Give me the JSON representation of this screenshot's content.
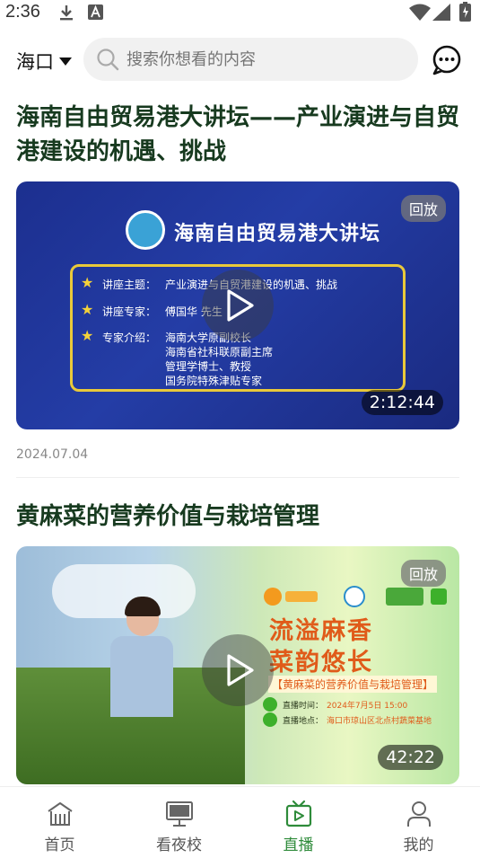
{
  "status_bar": {
    "time": "2:36"
  },
  "header": {
    "city": "海口",
    "search_placeholder": "搜索你想看的内容"
  },
  "feed": [
    {
      "title": "海南自由贸易港大讲坛——产业演进与自贸港建设的机遇、挑战",
      "badge": "回放",
      "duration": "2:12:44",
      "date": "2024.07.04",
      "thumbnail": {
        "banner_title": "海南自由贸易港大讲坛",
        "lines": [
          {
            "label": "讲座主题：",
            "text": "产业演进与自贸港建设的机遇、挑战"
          },
          {
            "label": "讲座专家：",
            "text": "傅国华  先生"
          },
          {
            "label": "专家介绍：",
            "text": "海南大学原副校长"
          }
        ],
        "extra_lines": [
          "海南省社科联原副主席",
          "管理学博士、教授",
          "国务院特殊津贴专家"
        ]
      }
    },
    {
      "title": "黄麻菜的营养价值与栽培管理",
      "badge": "回放",
      "duration": "42:22",
      "thumbnail": {
        "slogan_1": "流溢麻香",
        "slogan_2": "菜韵悠长",
        "topic": "【黄麻菜的营养价值与栽培管理】",
        "info": [
          {
            "label": "直播时间：",
            "value": "2024年7月5日 15:00"
          },
          {
            "label": "直播地点：",
            "value": "海口市琼山区北点村蔬菜基地"
          }
        ]
      }
    }
  ],
  "tabbar": [
    {
      "label": "首页",
      "icon": "home-icon"
    },
    {
      "label": "看夜校",
      "icon": "monitor-icon"
    },
    {
      "label": "直播",
      "icon": "live-tv-icon",
      "active": true
    },
    {
      "label": "我的",
      "icon": "person-icon"
    }
  ],
  "colors": {
    "accent": "#2e8b3a",
    "title": "#173a1f"
  }
}
